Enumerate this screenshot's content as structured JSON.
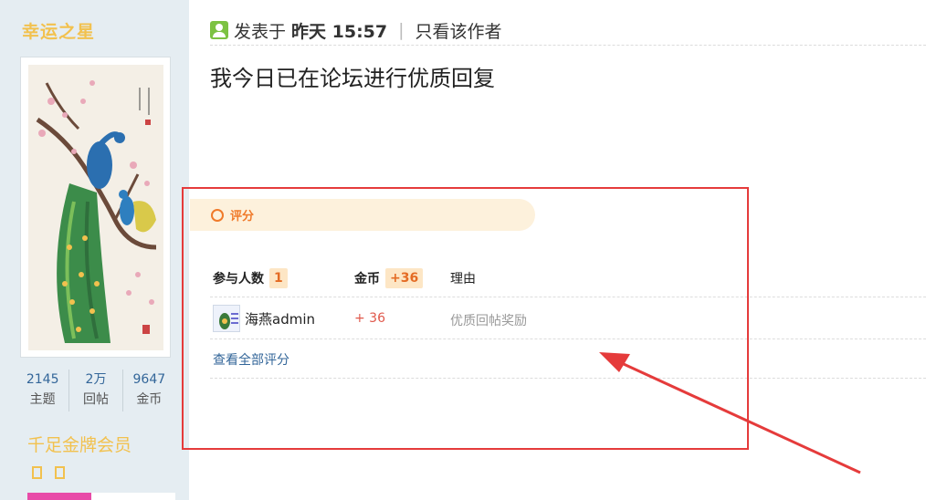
{
  "sidebar": {
    "username": "幸运之星",
    "stats": [
      {
        "value": "2145",
        "label": "主题"
      },
      {
        "value": "2万",
        "label": "回帖"
      },
      {
        "value": "9647",
        "label": "金币"
      }
    ],
    "rank": "千足金牌会员"
  },
  "post": {
    "posted_label": "发表于",
    "posted_time": "昨天 15:57",
    "only_author": "只看该作者",
    "content": "我今日已在论坛进行优质回复"
  },
  "rating": {
    "title": "评分",
    "participants_label": "参与人数",
    "participants_count": "1",
    "coin_label": "金币",
    "coin_total": "+36",
    "reason_label": "理由",
    "rows": [
      {
        "user": "海燕admin",
        "coin": "+ 36",
        "reason": "优质回帖奖励"
      }
    ],
    "view_all": "查看全部评分"
  },
  "colors": {
    "sidebar_bg": "#e5edf2",
    "username": "#f2c14e",
    "accent_orange": "#f07a2a",
    "highlight_red": "#e53b3b",
    "link_blue": "#336699"
  },
  "icons": [
    "online-status-icon",
    "rating-ring-icon",
    "user-avatar-icon",
    "peacock-avatar-image",
    "red-arrow-annotation"
  ]
}
